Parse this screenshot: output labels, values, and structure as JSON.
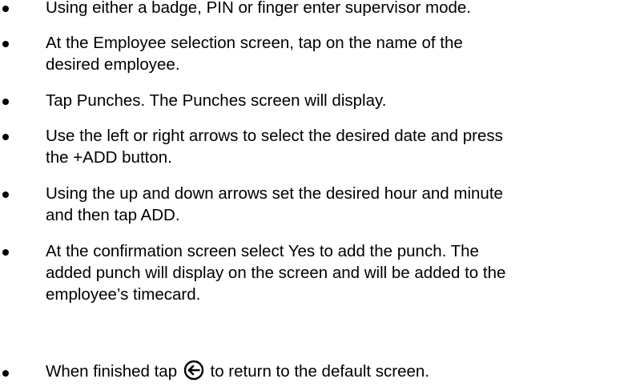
{
  "bullets": [
    {
      "lines": [
        "Using either a badge, PIN or finger enter supervisor mode."
      ]
    },
    {
      "lines": [
        "At the Employee selection screen, tap on the name of the",
        "desired employee."
      ]
    },
    {
      "lines": [
        "Tap Punches. The Punches screen will display."
      ]
    },
    {
      "lines": [
        "Use the left or right arrows to select the desired date and press",
        "the +ADD button."
      ]
    },
    {
      "lines": [
        "Using the up and down arrows set the desired hour and minute",
        "and then tap ADD."
      ]
    },
    {
      "lines": [
        "At the confirmation screen select Yes to add the punch. The",
        "added punch will display on the screen and will be added to the",
        "employee’s timecard."
      ]
    }
  ],
  "last_bullet": {
    "before_icon": "When finished tap",
    "icon": "back-arrow-circle-icon",
    "after_icon": "to return to the default screen."
  }
}
